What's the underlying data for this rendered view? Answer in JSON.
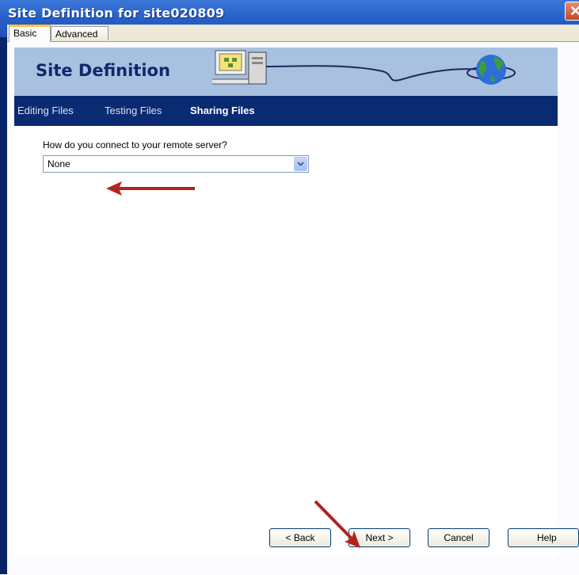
{
  "window": {
    "title": "Site Definition for site020809"
  },
  "tabs": [
    {
      "label": "Basic",
      "active": true
    },
    {
      "label": "Advanced",
      "active": false
    }
  ],
  "banner": {
    "title": "Site Definition"
  },
  "nav": [
    {
      "label": "Editing Files",
      "active": false
    },
    {
      "label": "Testing Files",
      "active": false
    },
    {
      "label": "Sharing Files",
      "active": true
    }
  ],
  "form": {
    "question": "How do you connect to your remote server?",
    "selected": "None"
  },
  "buttons": {
    "back": "< Back",
    "next": "Next >",
    "cancel": "Cancel",
    "help": "Help"
  },
  "colors": {
    "title_bar": "#2960c9",
    "nav_bar": "#0a2a72",
    "banner": "#a9c1e0",
    "annotation_arrow": "#b3231c"
  }
}
